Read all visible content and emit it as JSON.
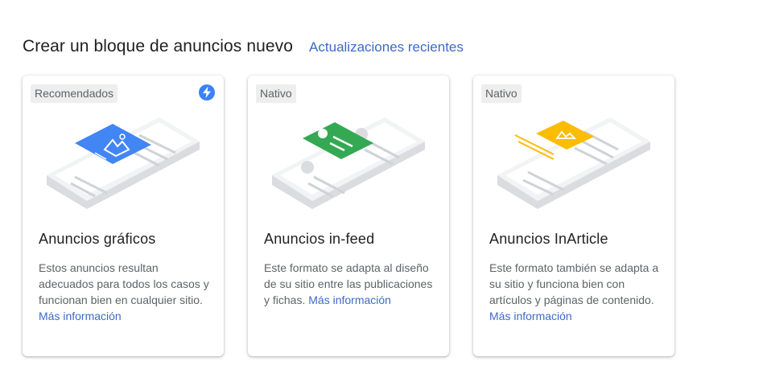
{
  "header": {
    "title": "Crear un bloque de anuncios nuevo",
    "recent_link": "Actualizaciones recientes"
  },
  "colors": {
    "accent_blue": "#4285f4",
    "accent_green": "#34a853",
    "accent_yellow": "#fbbc04",
    "link": "#3c6ac8"
  },
  "cards": [
    {
      "badge": "Recomendados",
      "has_bolt_icon": true,
      "illustration": "phone-display-ad-icon",
      "title": "Anuncios gráficos",
      "description": "Estos anuncios resultan adecuados para todos los casos y funcionan bien en cualquier sitio. ",
      "more_link": "Más información"
    },
    {
      "badge": "Nativo",
      "illustration": "phone-infeed-ad-icon",
      "title": "Anuncios in-feed",
      "description": "Este formato se adapta al diseño de su sitio entre las publicaciones y fichas. ",
      "more_link": "Más información"
    },
    {
      "badge": "Nativo",
      "illustration": "phone-inarticle-ad-icon",
      "title": "Anuncios InArticle",
      "description": "Este formato también se adapta a su sitio y funciona bien con artículos y páginas de contenido. ",
      "more_link": "Más información"
    }
  ]
}
